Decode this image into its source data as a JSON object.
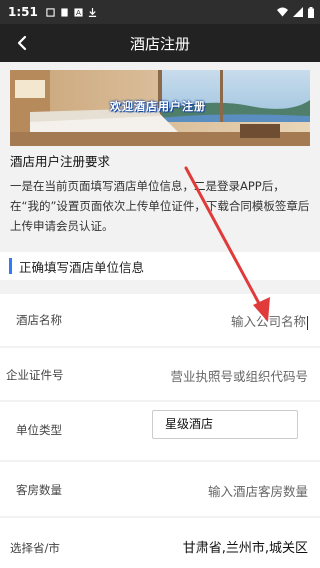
{
  "status_bar": {
    "time": "1:51",
    "notification_icons": [
      "notification-icon",
      "sim-icon",
      "text-icon",
      "download-icon"
    ],
    "system_icons": [
      "wifi-icon",
      "signal-icon",
      "battery-icon"
    ]
  },
  "header": {
    "title": "酒店注册",
    "back_icon": "chevron-left-icon"
  },
  "banner": {
    "text": "欢迎酒店用户注册"
  },
  "requirements": {
    "title": "酒店用户注册要求",
    "body": "一是在当前页面填写酒店单位信息，二是登录APP后，在“我的”设置页面依次上传单位证件，下载合同模板签章后上传申请会员认证。"
  },
  "section": {
    "title": "正确填写酒店单位信息"
  },
  "form": {
    "hotel_name": {
      "label": "酒店名称",
      "placeholder": "输入公司名称"
    },
    "license": {
      "label": "企业证件号",
      "placeholder": "营业执照号或组织代码号"
    },
    "unit_type": {
      "label": "单位类型",
      "value": "星级酒店"
    },
    "rooms": {
      "label": "客房数量",
      "placeholder": "输入酒店客房数量"
    },
    "region": {
      "label": "选择省/市",
      "value": "甘肃省,兰州市,城关区"
    }
  },
  "colors": {
    "accent": "#2f7cf6",
    "header_bg": "#222222",
    "annotation_arrow": "#e03a3a"
  }
}
